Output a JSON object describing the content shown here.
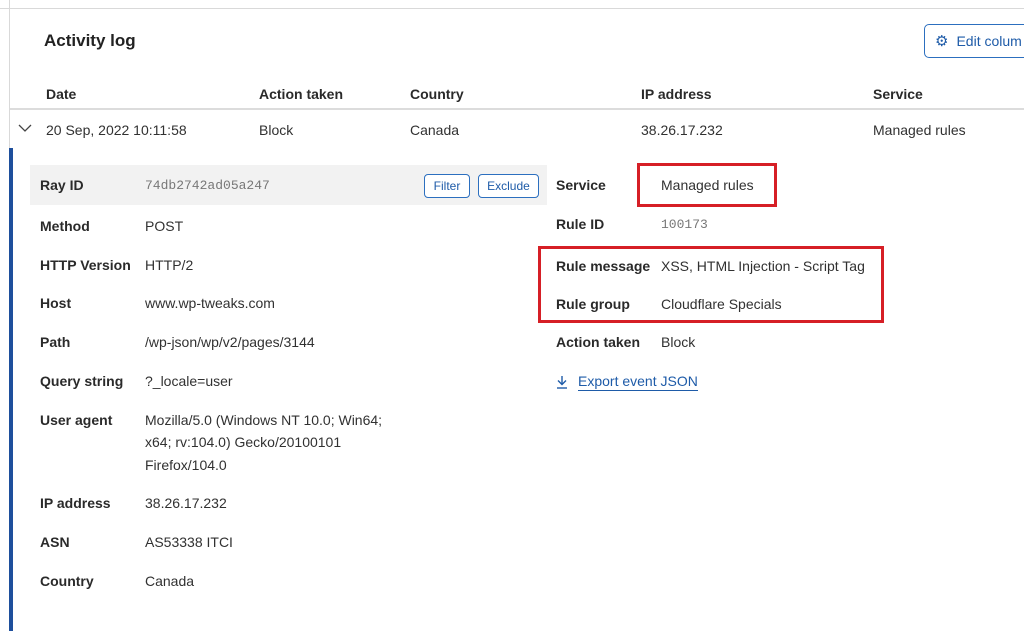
{
  "header": {
    "title": "Activity log",
    "edit_columns_label": "Edit colum",
    "edit_icon": "gear-icon"
  },
  "table": {
    "columns": [
      "Date",
      "Action taken",
      "Country",
      "IP address",
      "Service"
    ],
    "rows": [
      {
        "date": "20 Sep, 2022 10:11:58",
        "action": "Block",
        "country": "Canada",
        "ip": "38.26.17.232",
        "service": "Managed rules",
        "expanded": true
      }
    ]
  },
  "details": {
    "left": [
      {
        "label": "Ray ID",
        "value": "74db2742ad05a247"
      },
      {
        "label": "Method",
        "value": "POST"
      },
      {
        "label": "HTTP Version",
        "value": "HTTP/2"
      },
      {
        "label": "Host",
        "value": "www.wp-tweaks.com"
      },
      {
        "label": "Path",
        "value": "/wp-json/wp/v2/pages/3144"
      },
      {
        "label": "Query string",
        "value": "?_locale=user"
      },
      {
        "label": "User agent",
        "value_lines": [
          "Mozilla/5.0 (Windows NT 10.0; Win64;",
          "x64; rv:104.0) Gecko/20100101",
          "Firefox/104.0"
        ]
      },
      {
        "label": "IP address",
        "value": "38.26.17.232"
      },
      {
        "label": "ASN",
        "value": "AS53338 ITCI"
      },
      {
        "label": "Country",
        "value": "Canada"
      }
    ],
    "ray_buttons": {
      "filter": "Filter",
      "exclude": "Exclude"
    },
    "right": [
      {
        "label": "Service",
        "value": "Managed rules"
      },
      {
        "label": "Rule ID",
        "value": "100173"
      },
      {
        "label": "Rule message",
        "value": "XSS, HTML Injection - Script Tag"
      },
      {
        "label": "Rule group",
        "value": "Cloudflare Specials"
      },
      {
        "label": "Action taken",
        "value": "Block"
      }
    ],
    "export_label": "Export event JSON",
    "export_icon": "download-icon"
  },
  "colors": {
    "accent": "#1e5ba8",
    "highlight": "#d61f26",
    "expand_bar": "#1e4f9c"
  }
}
